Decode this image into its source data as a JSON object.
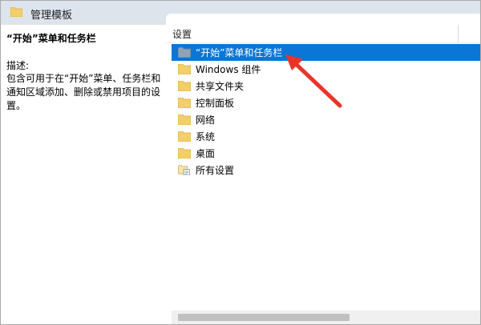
{
  "header": {
    "title": "管理模板",
    "folder_icon": "folder-icon"
  },
  "description": {
    "title": "“开始”菜单和任务栏",
    "label": "描述:",
    "body": "包含可用于在“开始”菜单、任务栏和通知区域添加、删除或禁用项目的设置。"
  },
  "list": {
    "column_header": "设置",
    "items": [
      {
        "label": "“开始”菜单和任务栏",
        "icon": "folder-icon",
        "selected": true
      },
      {
        "label": "Windows 组件",
        "icon": "folder-icon",
        "selected": false
      },
      {
        "label": "共享文件夹",
        "icon": "folder-icon",
        "selected": false
      },
      {
        "label": "控制面板",
        "icon": "folder-icon",
        "selected": false
      },
      {
        "label": "网络",
        "icon": "folder-icon",
        "selected": false
      },
      {
        "label": "系统",
        "icon": "folder-icon",
        "selected": false
      },
      {
        "label": "桌面",
        "icon": "folder-icon",
        "selected": false
      },
      {
        "label": "所有设置",
        "icon": "all-settings-icon",
        "selected": false
      }
    ]
  },
  "colors": {
    "selection": "#0a76d6",
    "header_band": "#dde4ec",
    "annotation_arrow": "#e8352b",
    "folder_yellow": "#f3cf6a"
  }
}
